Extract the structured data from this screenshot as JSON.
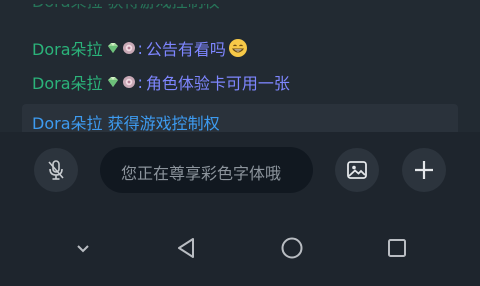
{
  "chat": {
    "cut_off_message": "Dora朵拉 获得游戏控制权",
    "messages": [
      {
        "user": "Dora朵拉",
        "separator": ":",
        "text": "公告有看吗",
        "emoji": "grinning-face-icon"
      },
      {
        "user": "Dora朵拉",
        "separator": ":",
        "text": "角色体验卡可用一张"
      }
    ],
    "notice": "Dora朵拉 获得游戏控制权"
  },
  "toolbar": {
    "input_placeholder": "您正在尊享彩色字体哦",
    "icons": [
      "mic-off-icon",
      "image-icon",
      "plus-icon"
    ]
  },
  "nav_bar": {
    "icons": [
      "chevron-down-icon",
      "back-icon",
      "home-icon",
      "recents-icon"
    ]
  },
  "colors": {
    "background": "#1e252d",
    "chat_background": "#222a32",
    "username": "#2bb37a",
    "message_text": "#7e86ff",
    "notice_text": "#3d9bf0",
    "input_background": "#111820",
    "button_background": "#2c343d"
  }
}
